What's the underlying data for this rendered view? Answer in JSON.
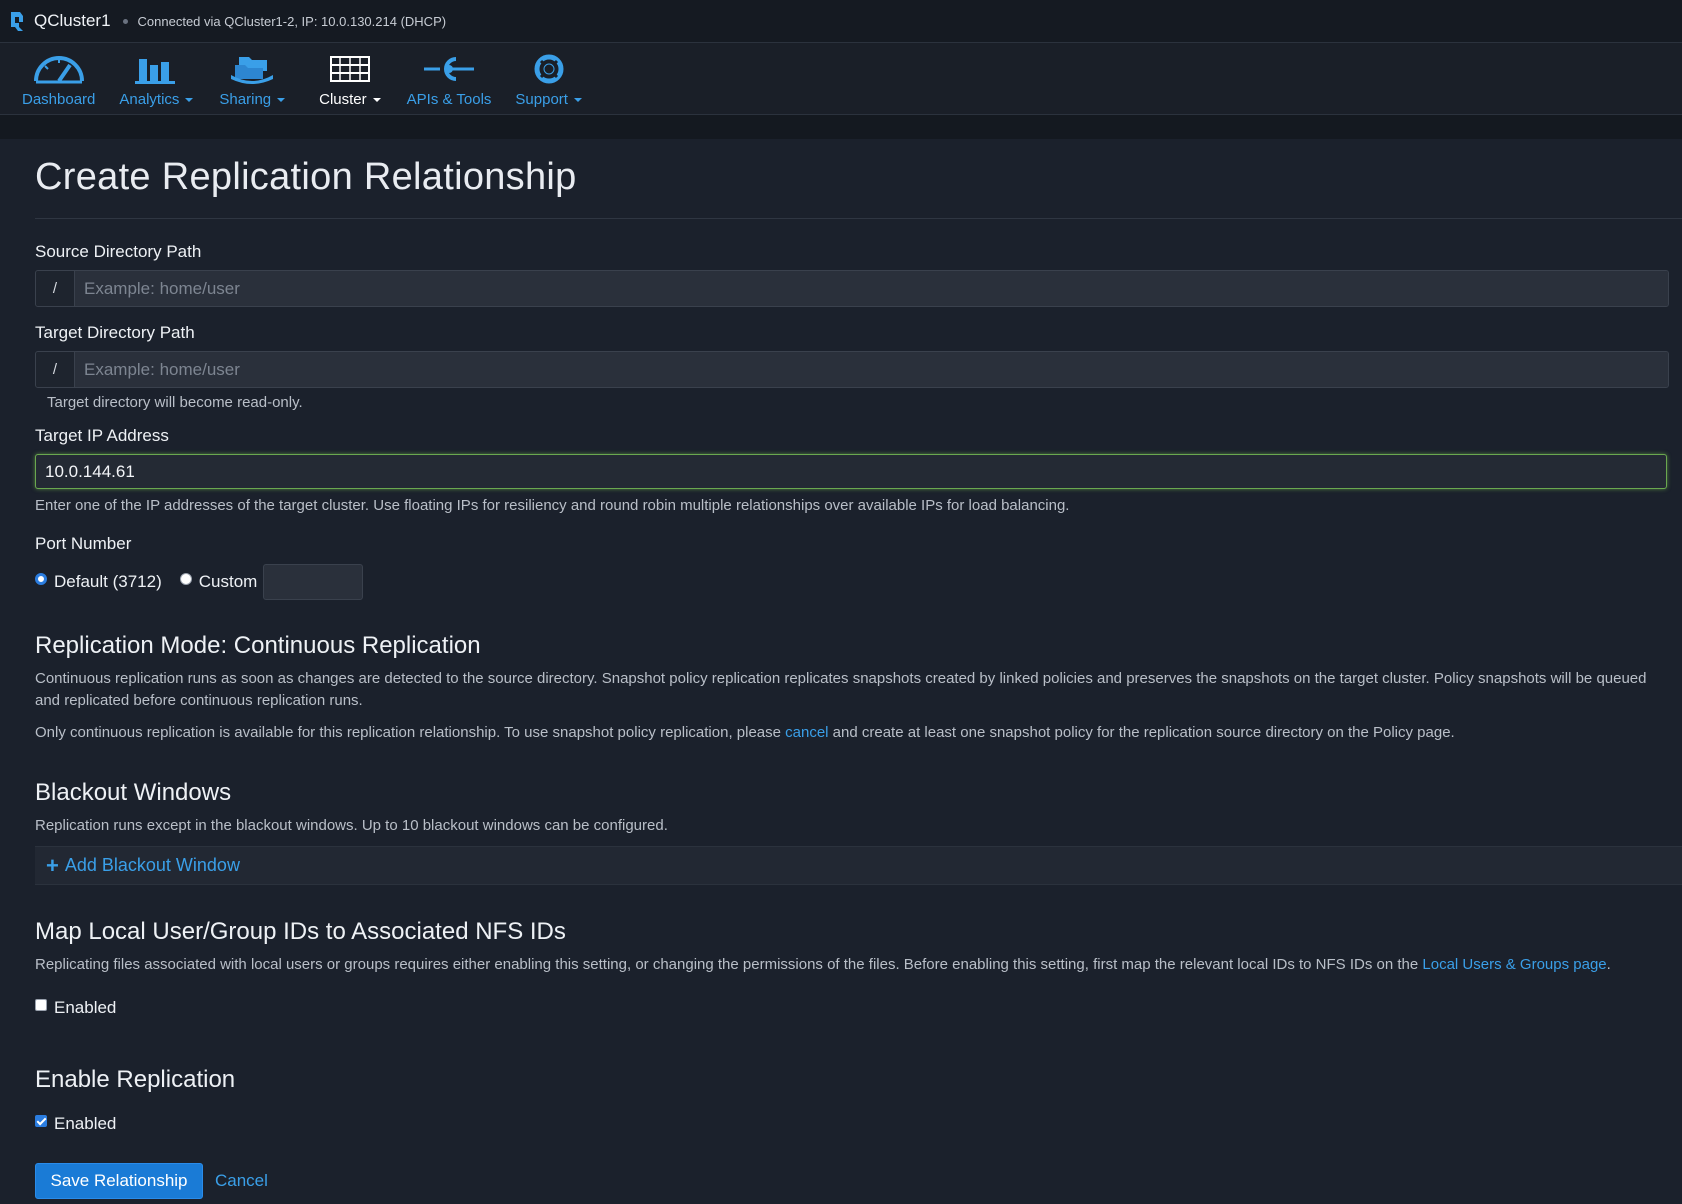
{
  "app": {
    "title": "QCluster1",
    "connection": "Connected via QCluster1-2, IP: 10.0.130.214 (DHCP)"
  },
  "nav": {
    "items": [
      {
        "label": "Dashboard",
        "icon": "gauge-icon"
      },
      {
        "label": "Analytics",
        "icon": "bar-chart-icon"
      },
      {
        "label": "Sharing",
        "icon": "folders-icon"
      },
      {
        "label": "Cluster",
        "icon": "server-icon"
      },
      {
        "label": "APIs & Tools",
        "icon": "api-icon"
      },
      {
        "label": "Support",
        "icon": "lifebuoy-icon"
      }
    ]
  },
  "page": {
    "title": "Create Replication Relationship"
  },
  "form": {
    "source": {
      "label": "Source Directory Path",
      "prefix": "/",
      "placeholder": "Example: home/user",
      "value": ""
    },
    "target": {
      "label": "Target Directory Path",
      "prefix": "/",
      "placeholder": "Example: home/user",
      "value": "",
      "help": "Target directory will become read-only."
    },
    "ip": {
      "label": "Target IP Address",
      "value": "10.0.144.61",
      "help": "Enter one of the IP addresses of the target cluster. Use floating IPs for resiliency and round robin multiple relationships over available IPs for load balancing."
    },
    "port": {
      "label": "Port Number",
      "default_label": "Default (3712)",
      "custom_label": "Custom",
      "selected": "default",
      "custom_value": ""
    }
  },
  "mode": {
    "title": "Replication Mode: Continuous Replication",
    "desc": "Continuous replication runs as soon as changes are detected to the source directory. Snapshot policy replication replicates snapshots created by linked policies and preserves the snapshots on the target cluster. Policy snapshots will be queued and replicated before continuous replication runs.",
    "note_before": "Only continuous replication is available for this replication relationship. To use snapshot policy replication, please ",
    "note_link": "cancel",
    "note_after": " and create at least one snapshot policy for the replication source directory on the Policy page."
  },
  "blackout": {
    "title": "Blackout Windows",
    "desc": "Replication runs except in the blackout windows. Up to 10 blackout windows can be configured.",
    "add_label": "Add Blackout Window"
  },
  "mapping": {
    "title": "Map Local User/Group IDs to Associated NFS IDs",
    "desc_before": "Replicating files associated with local users or groups requires either enabling this setting, or changing the permissions of the files. Before enabling this setting, first map the relevant local IDs to NFS IDs on the ",
    "desc_link": "Local Users & Groups page",
    "desc_after": ".",
    "checkbox_label": "Enabled",
    "checked": false
  },
  "enable": {
    "title": "Enable Replication",
    "checkbox_label": "Enabled",
    "checked": true
  },
  "actions": {
    "save_label": "Save Relationship",
    "cancel_label": "Cancel"
  },
  "colors": {
    "accent": "#3a9fe8",
    "button": "#1a7bd6",
    "valid": "#6aa84f"
  }
}
